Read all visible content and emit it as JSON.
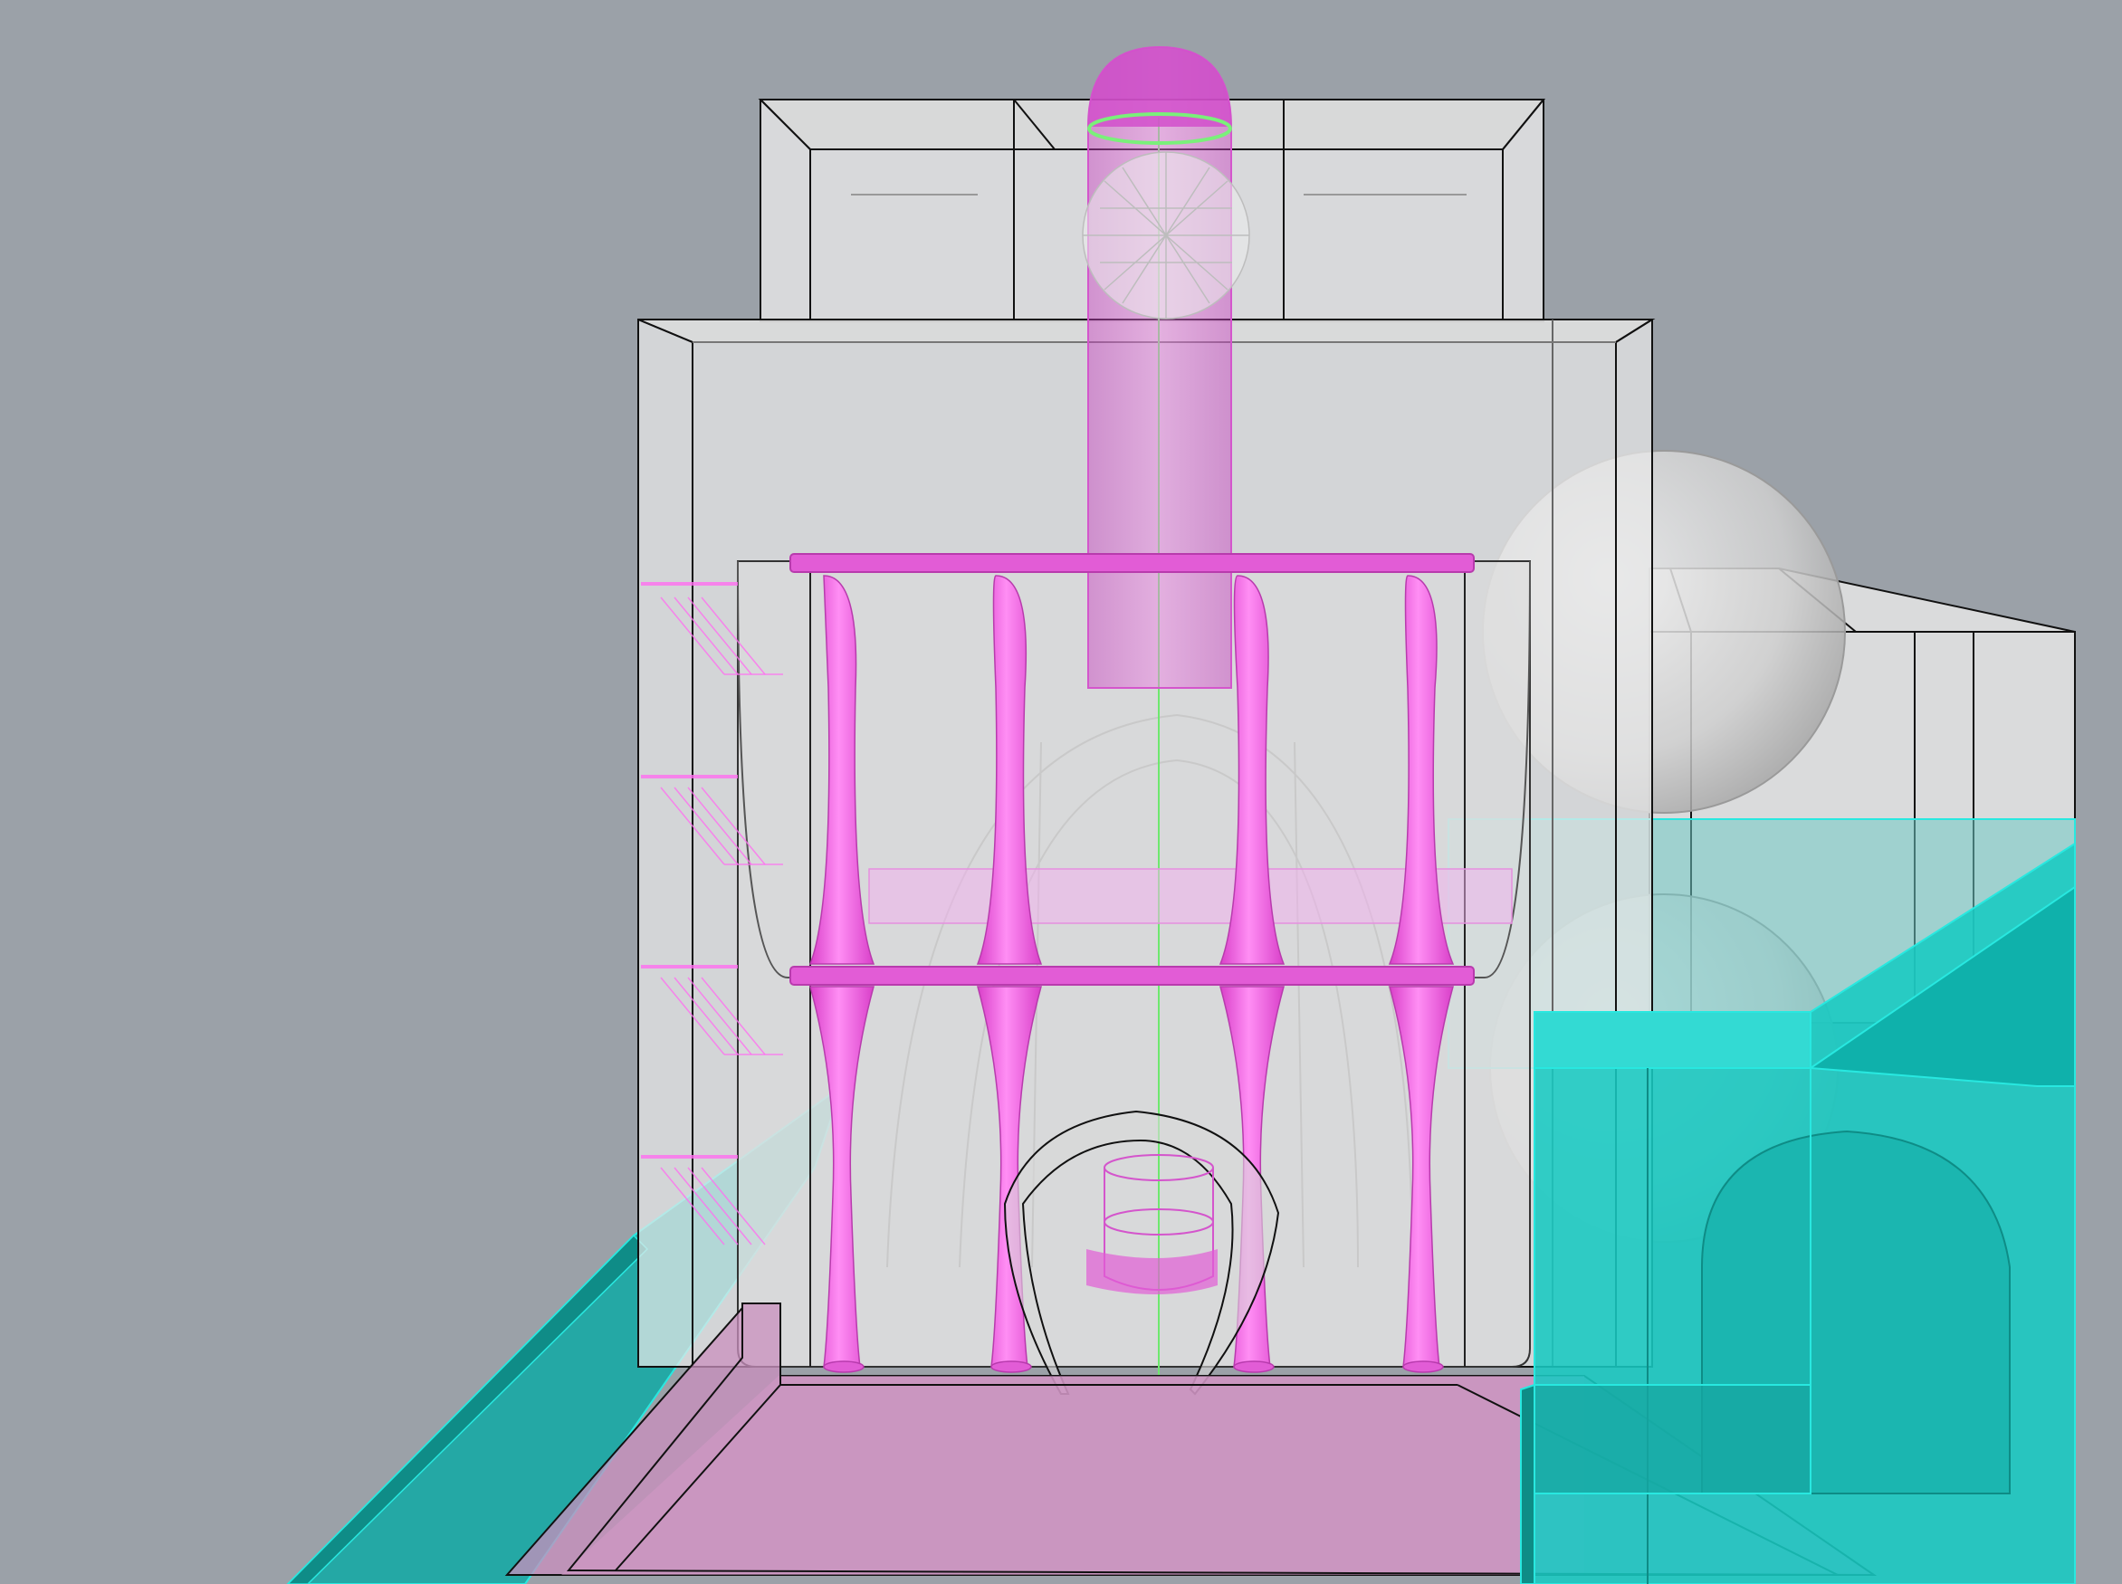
{
  "viewport": {
    "label": "",
    "background_color": "#9ba1a8"
  },
  "materials": {
    "ghost_white": "#e9e9e9",
    "edge_black": "#111111",
    "magenta": "#ff4fe8",
    "magenta_dark": "#d43fc4",
    "cyan": "#19d6cf",
    "cyan_dark": "#0f8c87",
    "axis_green": "#6ee86e"
  },
  "scene_objects": [
    "upper-box",
    "lower-box",
    "right-annex",
    "sphere-right-upper",
    "sphere-right-lower",
    "glass-drum",
    "column-frame",
    "hyperboloid-columns",
    "capsule-top",
    "geodesic-sphere",
    "arch-shell",
    "stair-ramps",
    "cyan-left-slab",
    "cyan-right-block",
    "tray-base"
  ]
}
